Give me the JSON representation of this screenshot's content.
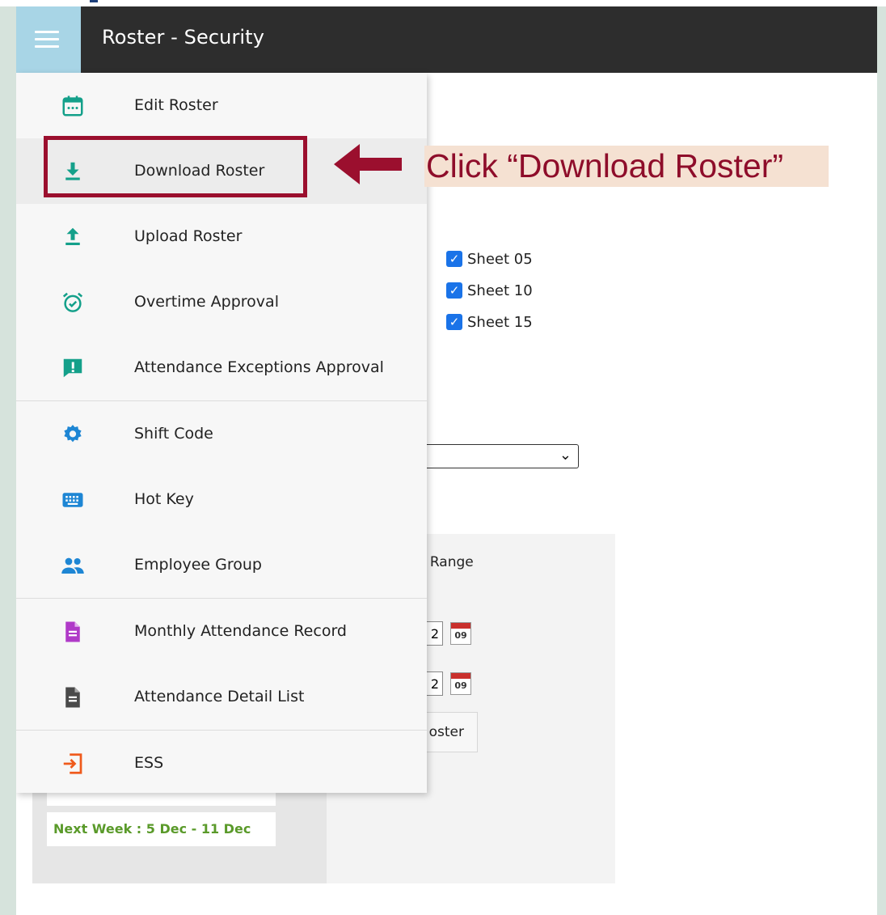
{
  "app": {
    "title": "Roster - Security"
  },
  "colors": {
    "appbar": "#2d2d2d",
    "hamburger_bg": "#a8d5e6",
    "icon_teal": "#14a08a",
    "icon_blue": "#1e86d4",
    "icon_purple": "#b03ac8",
    "icon_orange": "#ef5a1c",
    "icon_gray": "#4a4a4a",
    "annotation": "#9b0f2e",
    "annotation_bg": "#f5e1d2",
    "week_text": "#5a9a2a"
  },
  "menu": {
    "items": [
      {
        "label": "Edit Roster",
        "icon": "calendar-icon"
      },
      {
        "label": "Download Roster",
        "icon": "download-icon",
        "active": true
      },
      {
        "label": "Upload Roster",
        "icon": "upload-icon"
      },
      {
        "label": "Overtime Approval",
        "icon": "alarm-check-icon"
      },
      {
        "label": "Attendance Exceptions Approval",
        "icon": "exclamation-message-icon"
      },
      {
        "label": "Shift Code",
        "icon": "gear-icon"
      },
      {
        "label": "Hot Key",
        "icon": "keyboard-icon"
      },
      {
        "label": "Employee Group",
        "icon": "people-icon"
      },
      {
        "label": "Monthly Attendance Record",
        "icon": "document-purple-icon"
      },
      {
        "label": "Attendance Detail List",
        "icon": "document-gray-icon"
      },
      {
        "label": "ESS",
        "icon": "login-arrow-icon"
      }
    ]
  },
  "annotation": {
    "text": "Click “Download Roster”"
  },
  "background": {
    "sheets": [
      "Sheet 05",
      "Sheet 10",
      "Sheet 15"
    ],
    "range_label": "e Range",
    "date_fragments": [
      "2",
      "2"
    ],
    "calendar_day": "09",
    "roster_button_fragment": "oster",
    "next_week": "Next Week : 5 Dec - 11 Dec"
  }
}
